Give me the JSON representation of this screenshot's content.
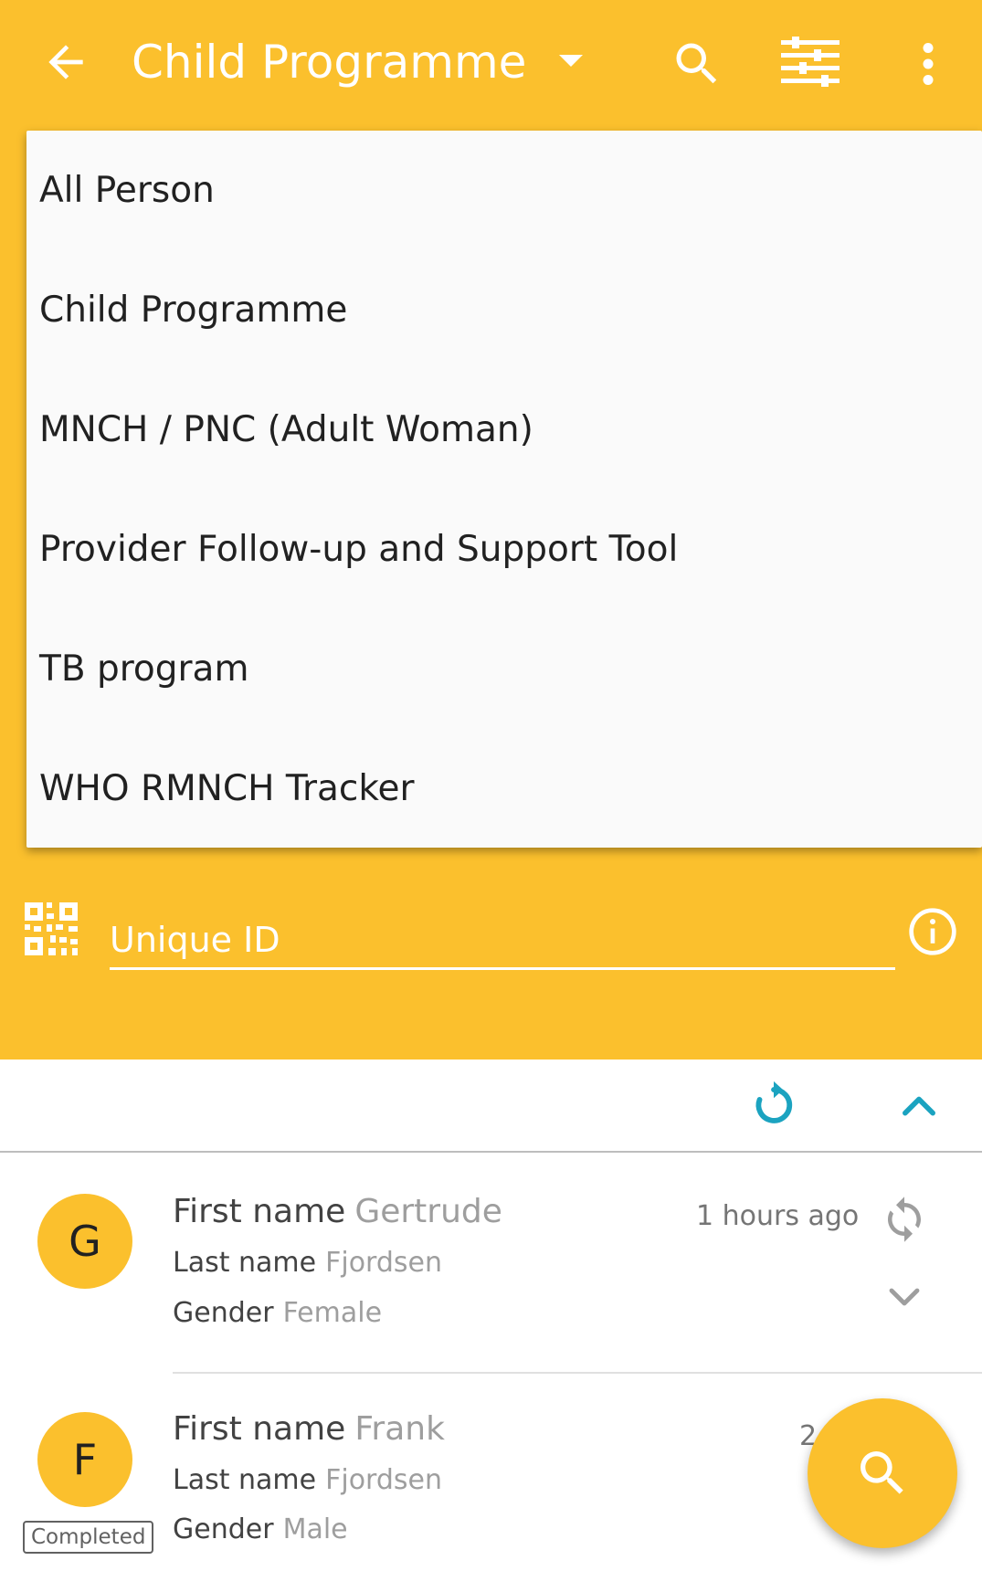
{
  "colors": {
    "primary": "#fbc02d",
    "accent_teal": "#1ba3c0",
    "menu_bg": "#fafafa"
  },
  "toolbar": {
    "title": "Child Programme",
    "icons": [
      "back-arrow-icon",
      "dropdown-caret-icon",
      "search-icon",
      "filter-sliders-icon",
      "more-vert-icon"
    ]
  },
  "program_menu": {
    "items": [
      {
        "label": "All Person"
      },
      {
        "label": "Child Programme"
      },
      {
        "label": "MNCH / PNC (Adult Woman)"
      },
      {
        "label": "Provider Follow-up and Support Tool"
      },
      {
        "label": "TB program"
      },
      {
        "label": "WHO RMNCH Tracker"
      }
    ]
  },
  "search": {
    "unique_id_label": "Unique ID"
  },
  "list": {
    "records": [
      {
        "initial": "G",
        "first_name_label": "First name",
        "first_name": "Gertrude",
        "last_name_label": "Last name",
        "last_name": "Fjordsen",
        "gender_label": "Gender",
        "gender": "Female",
        "time": "1 hours ago"
      },
      {
        "initial": "F",
        "first_name_label": "First name",
        "first_name": "Frank",
        "last_name_label": "Last name",
        "last_name": "Fjordsen",
        "gender_label": "Gender",
        "gender": "Male",
        "status_badge": "Completed",
        "time_clipped": "2"
      }
    ]
  }
}
